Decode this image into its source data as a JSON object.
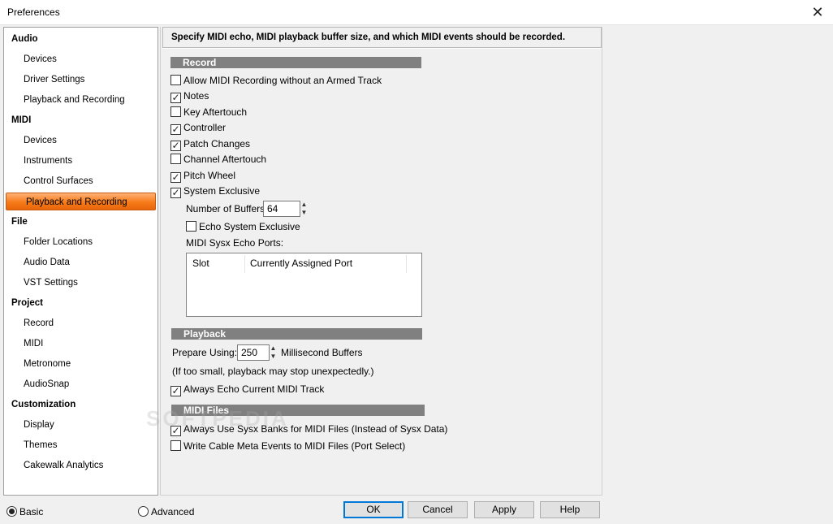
{
  "window": {
    "title": "Preferences"
  },
  "nav": {
    "items": [
      {
        "label": "Audio"
      },
      {
        "label": "Devices"
      },
      {
        "label": "Driver Settings"
      },
      {
        "label": "Playback and Recording"
      },
      {
        "label": "MIDI"
      },
      {
        "label": "Devices"
      },
      {
        "label": "Instruments"
      },
      {
        "label": "Control Surfaces"
      },
      {
        "label": "Playback and Recording"
      },
      {
        "label": "File"
      },
      {
        "label": "Folder Locations"
      },
      {
        "label": "Audio Data"
      },
      {
        "label": "VST Settings"
      },
      {
        "label": "Project"
      },
      {
        "label": "Record"
      },
      {
        "label": "MIDI"
      },
      {
        "label": "Metronome"
      },
      {
        "label": "AudioSnap"
      },
      {
        "label": "Customization"
      },
      {
        "label": "Display"
      },
      {
        "label": "Themes"
      },
      {
        "label": "Cakewalk Analytics"
      }
    ],
    "selected_color": "#f77b18"
  },
  "content": {
    "header": "Specify MIDI echo, MIDI playback buffer size, and which MIDI events should be recorded.",
    "record": {
      "title": "Record",
      "options": [
        {
          "label": "Allow MIDI Recording without an Armed Track",
          "checked": false
        },
        {
          "label": "Notes",
          "checked": true
        },
        {
          "label": "Key Aftertouch",
          "checked": false
        },
        {
          "label": "Controller",
          "checked": true
        },
        {
          "label": "Patch Changes",
          "checked": true
        },
        {
          "label": "Channel Aftertouch",
          "checked": false
        },
        {
          "label": "Pitch Wheel",
          "checked": true
        },
        {
          "label": "System Exclusive",
          "checked": true
        }
      ],
      "buffers_label": "Number of Buffers:",
      "buffers_value": "64",
      "echo_sysex": {
        "label": "Echo System Exclusive",
        "checked": false
      },
      "ports_label": "MIDI Sysx Echo Ports:",
      "ports_columns": [
        "Slot",
        "Currently Assigned Port"
      ]
    },
    "playback": {
      "title": "Playback",
      "prepare_label": "Prepare Using:",
      "prepare_value": "250",
      "prepare_unit": "Millisecond Buffers",
      "note": "(If too small, playback may stop unexpectedly.)",
      "always_echo": {
        "label": "Always Echo Current MIDI Track",
        "checked": true
      }
    },
    "midi_files": {
      "title": "MIDI Files",
      "options": [
        {
          "label": "Always Use Sysx Banks for MIDI Files (Instead of Sysx Data)",
          "checked": true
        },
        {
          "label": "Write Cable Meta Events to MIDI Files (Port Select)",
          "checked": false
        }
      ]
    },
    "watermark": "SOFTPEDIA"
  },
  "footer": {
    "basic": {
      "label": "Basic",
      "selected": true
    },
    "advanced": {
      "label": "Advanced",
      "selected": false
    },
    "buttons": {
      "ok": "OK",
      "cancel": "Cancel",
      "apply": "Apply",
      "help": "Help"
    }
  },
  "icons": {
    "close": "close-icon",
    "check": "check-icon",
    "spin_up": "spin-up-icon",
    "spin_down": "spin-down-icon"
  }
}
